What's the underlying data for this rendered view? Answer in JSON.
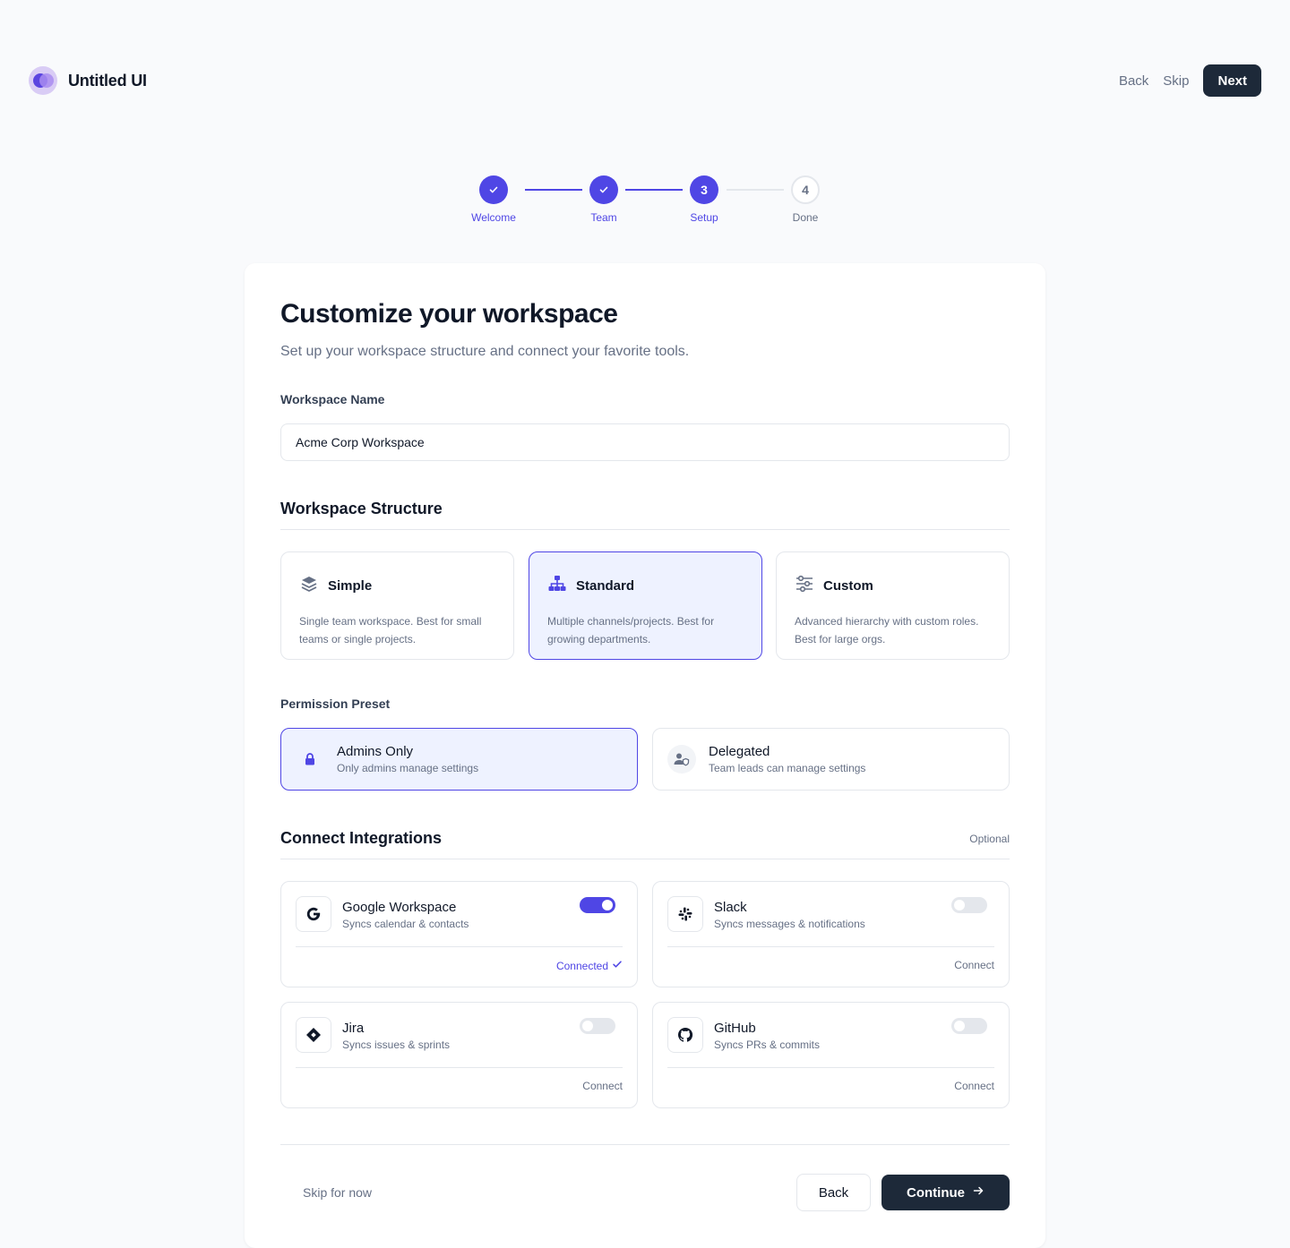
{
  "header": {
    "brand": "Untitled UI",
    "back_label": "Back",
    "skip_label": "Skip",
    "next_label": "Next"
  },
  "stepper": {
    "steps": [
      {
        "label": "Welcome",
        "number": "1",
        "state": "done"
      },
      {
        "label": "Team",
        "number": "2",
        "state": "done"
      },
      {
        "label": "Setup",
        "number": "3",
        "state": "active"
      },
      {
        "label": "Done",
        "number": "4",
        "state": "todo"
      }
    ]
  },
  "main": {
    "title": "Customize your workspace",
    "subtitle": "Set up your workspace structure and connect your favorite tools.",
    "workspace_name_label": "Workspace Name",
    "workspace_name_value": "Acme Corp Workspace",
    "structure_title": "Workspace Structure",
    "structures": [
      {
        "name": "Simple",
        "desc": "Single team workspace. Best for small teams or single projects.",
        "icon": "layers-icon",
        "selected": false
      },
      {
        "name": "Standard",
        "desc": "Multiple channels/projects. Best for growing departments.",
        "icon": "hierarchy-icon",
        "selected": true
      },
      {
        "name": "Custom",
        "desc": "Advanced hierarchy with custom roles. Best for large orgs.",
        "icon": "sliders-icon",
        "selected": false
      }
    ],
    "permission_label": "Permission Preset",
    "permissions": [
      {
        "name": "Admins Only",
        "desc": "Only admins manage settings",
        "icon": "lock-icon",
        "selected": true
      },
      {
        "name": "Delegated",
        "desc": "Team leads can manage settings",
        "icon": "user-shield-icon",
        "selected": false
      }
    ],
    "integrations_title": "Connect Integrations",
    "integrations_optional": "Optional",
    "integrations": [
      {
        "name": "Google Workspace",
        "desc": "Syncs calendar & contacts",
        "icon": "google-icon",
        "enabled": true,
        "status": "Connected"
      },
      {
        "name": "Slack",
        "desc": "Syncs messages & notifications",
        "icon": "slack-icon",
        "enabled": false,
        "status": "Connect"
      },
      {
        "name": "Jira",
        "desc": "Syncs issues & sprints",
        "icon": "jira-icon",
        "enabled": false,
        "status": "Connect"
      },
      {
        "name": "GitHub",
        "desc": "Syncs PRs & commits",
        "icon": "github-icon",
        "enabled": false,
        "status": "Connect"
      }
    ]
  },
  "footer": {
    "skip_label": "Skip for now",
    "back_label": "Back",
    "continue_label": "Continue"
  },
  "colors": {
    "accent": "#4f46e5",
    "accent_bg": "#eef2ff",
    "dark": "#1d2939",
    "muted": "#667085",
    "border": "#e4e7ec"
  }
}
